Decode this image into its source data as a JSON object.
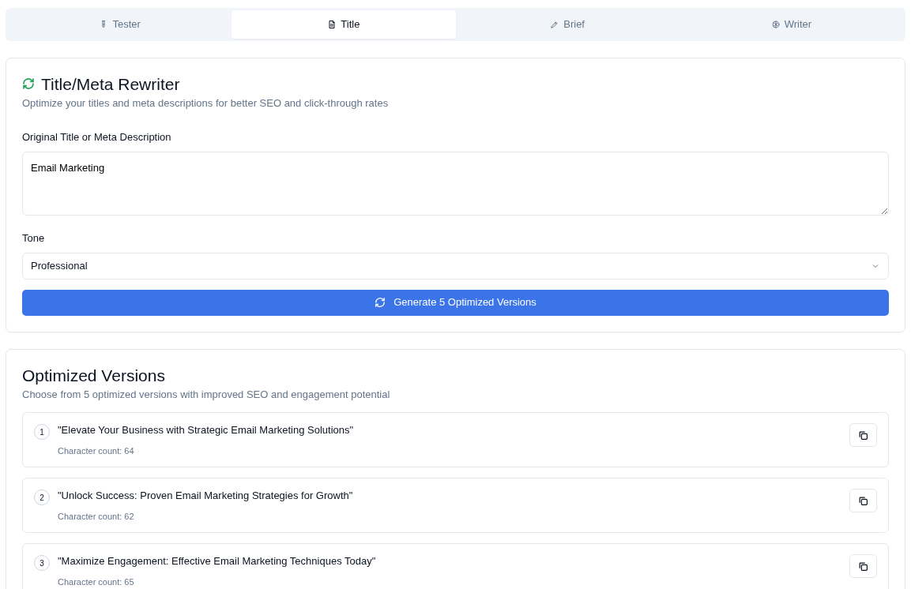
{
  "tabs": [
    {
      "label": "Tester",
      "selected": false
    },
    {
      "label": "Title",
      "selected": true
    },
    {
      "label": "Brief",
      "selected": false
    },
    {
      "label": "Writer",
      "selected": false
    }
  ],
  "rewriter": {
    "title": "Title/Meta Rewriter",
    "subtitle": "Optimize your titles and meta descriptions for better SEO and click-through rates",
    "original_label": "Original Title or Meta Description",
    "original_value": "Email Marketing",
    "tone_label": "Tone",
    "tone_value": "Professional",
    "generate_button": "Generate 5 Optimized Versions"
  },
  "results": {
    "title": "Optimized Versions",
    "subtitle": "Choose from 5 optimized versions with improved SEO and engagement potential",
    "versions": [
      {
        "number": "1",
        "text": "\"Elevate Your Business with Strategic Email Marketing Solutions\"",
        "count": "Character count: 64"
      },
      {
        "number": "2",
        "text": "\"Unlock Success: Proven Email Marketing Strategies for Growth\"",
        "count": "Character count: 62"
      },
      {
        "number": "3",
        "text": "\"Maximize Engagement: Effective Email Marketing Techniques Today\"",
        "count": "Character count: 65"
      }
    ]
  }
}
